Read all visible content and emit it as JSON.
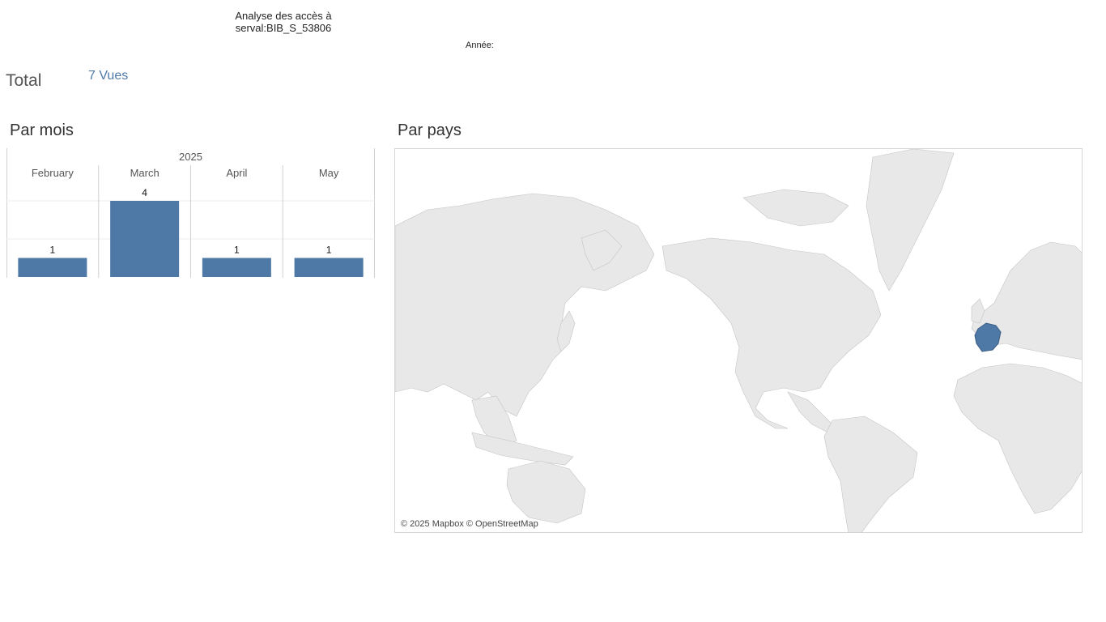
{
  "header": {
    "title_line1": "Analyse des accès à",
    "title_line2": "serval:BIB_S_53806",
    "year_filter_label": "Année:"
  },
  "summary": {
    "total_label": "Total",
    "total_value": "7 Vues"
  },
  "sections": {
    "by_month": "Par mois",
    "by_country": "Par pays"
  },
  "chart_data": {
    "type": "bar",
    "title": "Par mois",
    "year": "2025",
    "categories": [
      "February",
      "March",
      "April",
      "May"
    ],
    "values": [
      1,
      4,
      1,
      1
    ],
    "ylim": [
      0,
      4
    ],
    "bar_color": "#4e79a7",
    "grid": true
  },
  "map": {
    "highlighted_country": "France",
    "highlight_color": "#4e79a7",
    "land_color": "#e8e8e8",
    "attribution": "© 2025 Mapbox © OpenStreetMap"
  }
}
